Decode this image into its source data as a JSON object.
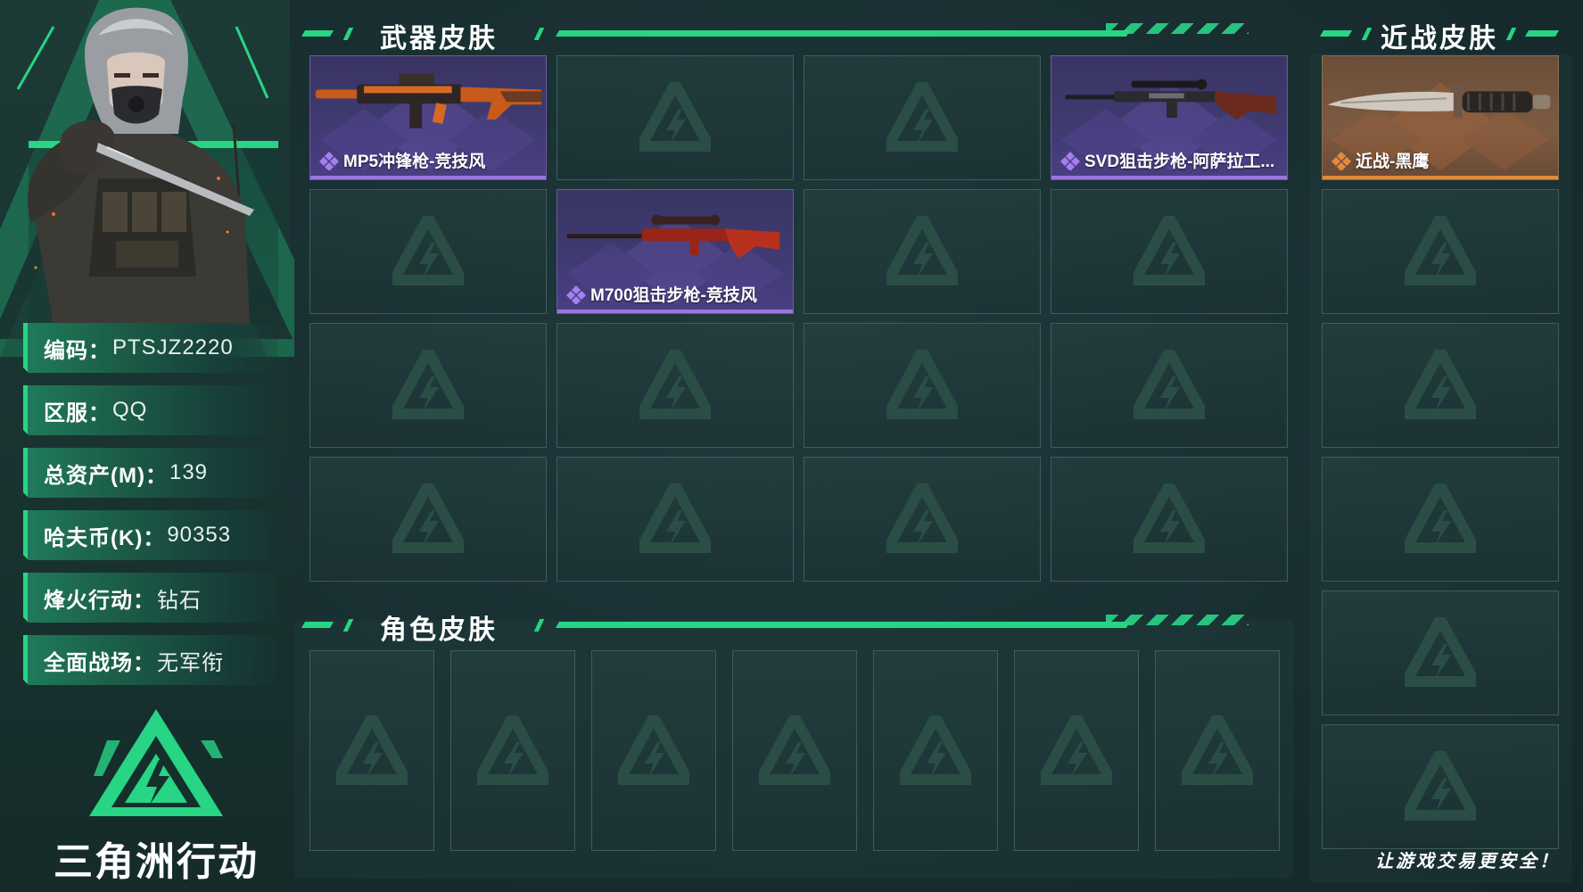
{
  "profile": {
    "rows": [
      {
        "label": "编码：",
        "value": "PTSJZ2220"
      },
      {
        "label": "区服：",
        "value": "QQ"
      },
      {
        "label": "总资产(M)：",
        "value": "139"
      },
      {
        "label": "哈夫币(K)：",
        "value": "90353"
      },
      {
        "label": "烽火行动：",
        "value": "钻石"
      },
      {
        "label": "全面战场：",
        "value": "无军衔"
      }
    ],
    "logo_text": "三角洲行动"
  },
  "weapon_skins": {
    "title": "武器皮肤",
    "slots": [
      {
        "label": "MP5冲锋枪-竞技风",
        "rarity": "purple",
        "icon": "mp5-gun-icon"
      },
      {
        "label": "",
        "rarity": "empty"
      },
      {
        "label": "",
        "rarity": "empty"
      },
      {
        "label": "SVD狙击步枪-阿萨拉工...",
        "rarity": "purple",
        "icon": "svd-rifle-icon"
      },
      {
        "label": "",
        "rarity": "empty"
      },
      {
        "label": "M700狙击步枪-竞技风",
        "rarity": "purple",
        "icon": "m700-rifle-icon"
      },
      {
        "label": "",
        "rarity": "empty"
      },
      {
        "label": "",
        "rarity": "empty"
      },
      {
        "label": "",
        "rarity": "empty"
      },
      {
        "label": "",
        "rarity": "empty"
      },
      {
        "label": "",
        "rarity": "empty"
      },
      {
        "label": "",
        "rarity": "empty"
      },
      {
        "label": "",
        "rarity": "empty"
      },
      {
        "label": "",
        "rarity": "empty"
      },
      {
        "label": "",
        "rarity": "empty"
      },
      {
        "label": "",
        "rarity": "empty"
      }
    ]
  },
  "melee_skins": {
    "title": "近战皮肤",
    "slots": [
      {
        "label": "近战-黑鹰",
        "rarity": "gold",
        "icon": "knife-icon"
      },
      {
        "label": "",
        "rarity": "empty"
      },
      {
        "label": "",
        "rarity": "empty"
      },
      {
        "label": "",
        "rarity": "empty"
      },
      {
        "label": "",
        "rarity": "empty"
      },
      {
        "label": "",
        "rarity": "empty"
      }
    ]
  },
  "character_skins": {
    "title": "角色皮肤",
    "slot_count": 7
  },
  "footer": {
    "slogan": "让游戏交易更安全！"
  },
  "colors": {
    "accent": "#27d585",
    "purple_rarity": "#9b74e0",
    "gold_rarity": "#e08a3c",
    "background": "#1a3134"
  }
}
